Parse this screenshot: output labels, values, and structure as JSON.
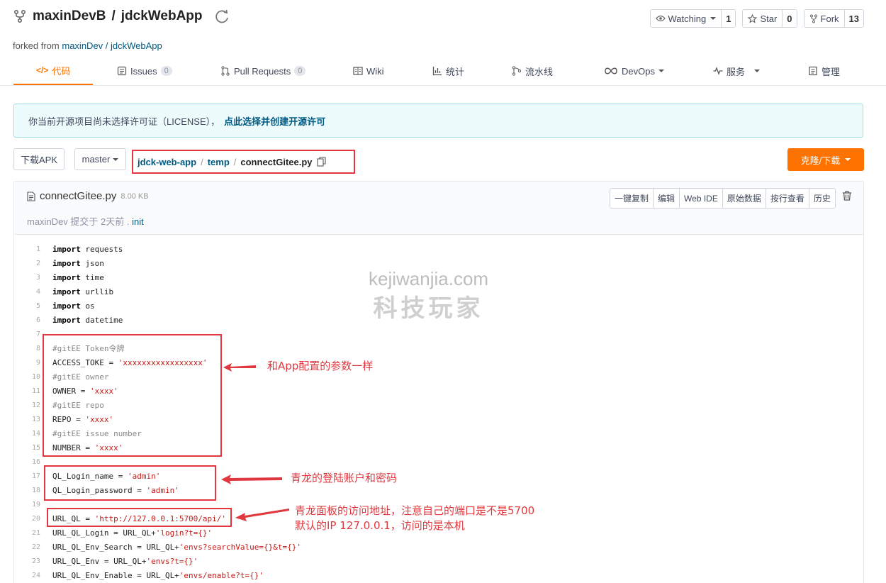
{
  "repo": {
    "owner": "maxinDevB",
    "sep": "/",
    "name": "jdckWebApp"
  },
  "forked": {
    "prefix": "forked from",
    "source": "maxinDev / jdckWebApp"
  },
  "actions": [
    {
      "label": "Watching",
      "count": "1",
      "icon": "eye-icon"
    },
    {
      "label": "Star",
      "count": "0",
      "icon": "star-icon"
    },
    {
      "label": "Fork",
      "count": "13",
      "icon": "fork-icon"
    }
  ],
  "tabs": [
    {
      "label": "代码",
      "icon": "code-icon"
    },
    {
      "label": "Issues",
      "badge": "0",
      "icon": "issues-icon"
    },
    {
      "label": "Pull Requests",
      "badge": "0",
      "icon": "pull-request-icon"
    },
    {
      "label": "Wiki",
      "icon": "book-icon"
    },
    {
      "label": "统计",
      "icon": "bar-chart-icon"
    },
    {
      "label": "流水线",
      "icon": "pipeline-icon"
    },
    {
      "label": "DevOps",
      "icon": "infinity-icon"
    },
    {
      "label": "服务",
      "icon": "pulse-icon"
    },
    {
      "label": "管理",
      "icon": "manage-icon"
    }
  ],
  "alert": {
    "text": "你当前开源项目尚未选择许可证（LICENSE），",
    "link": "点此选择并创建开源许可"
  },
  "toolbar": {
    "download_apk": "下载APK",
    "branch": "master",
    "clone": "克隆/下载"
  },
  "breadcrumb": {
    "root": "jdck-web-app",
    "folder": "temp",
    "file": "connectGitee.py",
    "sep": "/"
  },
  "file": {
    "name": "connectGitee.py",
    "size": "8.00 KB",
    "author": "maxinDev",
    "commit_text": "提交于 2天前 .",
    "commit_msg": "init",
    "buttons": [
      "一键复制",
      "编辑",
      "Web IDE",
      "原始数据",
      "按行查看",
      "历史"
    ]
  },
  "code_lines": [
    "import requests",
    "import json",
    "import time",
    "import urllib",
    "import os",
    "import datetime",
    "",
    "#gitEE Token令牌",
    "ACCESS_TOKE = 'xxxxxxxxxxxxxxxxx'",
    "#gitEE owner",
    "OWNER = 'xxxx'",
    "#gitEE repo",
    "REPO = 'xxxx'",
    "#gitEE issue number",
    "NUMBER = 'xxxx'",
    "",
    "QL_Login_name = 'admin'",
    "QL_Login_password = 'admin'",
    "",
    "URL_QL = 'http://127.0.0.1:5700/api/'",
    "URL_QL_Login = URL_QL+'login?t={}'",
    "URL_QL_Env_Search = URL_QL+'envs?searchValue={}&t={}'",
    "URL_QL_Env = URL_QL+'envs?t={}'",
    "URL_QL_Env_Enable = URL_QL+'envs/enable?t={}'"
  ],
  "annotations": {
    "note1": "和App配置的参数一样",
    "note2": "青龙的登陆账户和密码",
    "note3_line1": "青龙面板的访问地址，注意自己的端口是不是5700",
    "note3_line2": "默认的IP 127.0.0.1，访问的是本机"
  },
  "watermark": {
    "en": "kejiwanjia.com",
    "cn": "科技玩家"
  },
  "colors": {
    "accent": "#fe7300",
    "link": "#005980",
    "annotation": "#e0383e"
  }
}
